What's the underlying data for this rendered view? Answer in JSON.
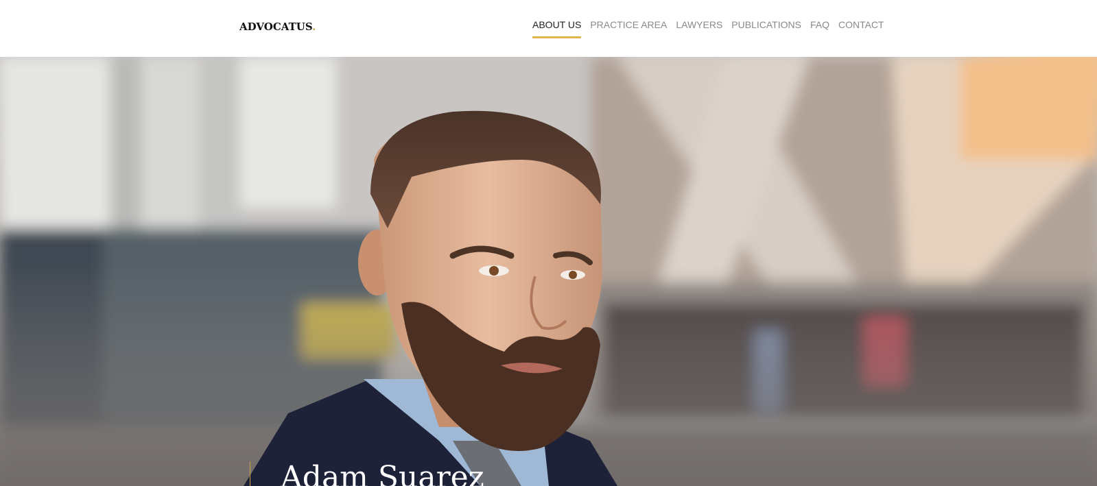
{
  "header": {
    "logo": "ADVOCATUS",
    "logo_dot": "."
  },
  "nav": {
    "items": [
      {
        "label": "ABOUT US",
        "active": true
      },
      {
        "label": "PRACTICE AREA",
        "active": false
      },
      {
        "label": "LAWYERS",
        "active": false
      },
      {
        "label": "PUBLICATIONS",
        "active": false
      },
      {
        "label": "FAQ",
        "active": false
      },
      {
        "label": "CONTACT",
        "active": false
      }
    ]
  },
  "hero": {
    "name": "Adam Suarez"
  },
  "colors": {
    "accent": "#e0b44c",
    "text_dark": "#222222",
    "text_muted": "#8a8a8a"
  }
}
